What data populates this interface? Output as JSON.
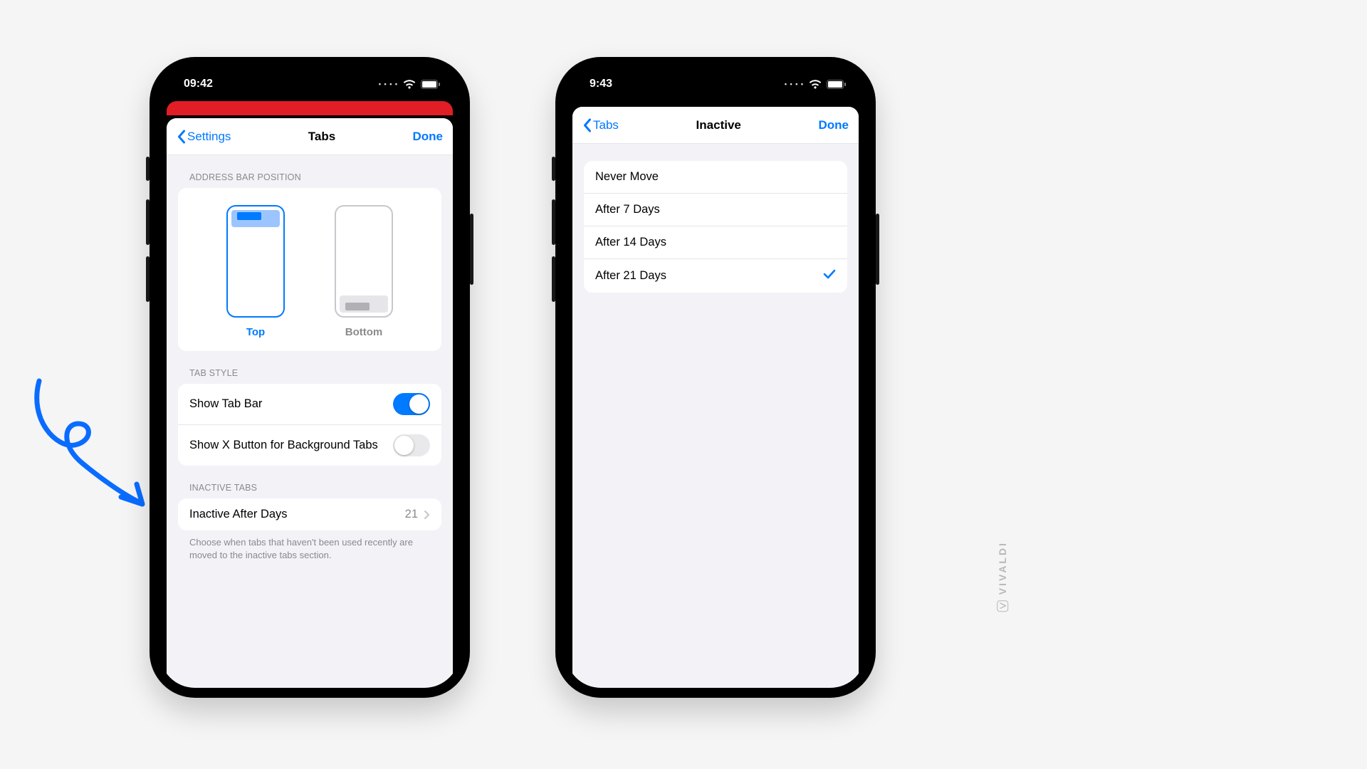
{
  "watermark": "VIVALDI",
  "left": {
    "status": {
      "time": "09:42"
    },
    "nav": {
      "back": "Settings",
      "title": "Tabs",
      "done": "Done"
    },
    "addressBarPosition": {
      "header": "ADDRESS BAR POSITION",
      "options": {
        "top": "Top",
        "bottom": "Bottom"
      },
      "selected": "top"
    },
    "tabStyle": {
      "header": "TAB STYLE",
      "showTabBar": {
        "label": "Show Tab Bar",
        "on": true
      },
      "showXButton": {
        "label": "Show X Button for Background Tabs",
        "on": false
      }
    },
    "inactiveTabs": {
      "header": "INACTIVE TABS",
      "row": {
        "label": "Inactive After Days",
        "value": "21"
      },
      "footer": "Choose when tabs that haven't been used recently are moved to the inactive tabs section."
    }
  },
  "right": {
    "status": {
      "time": "9:43"
    },
    "nav": {
      "back": "Tabs",
      "title": "Inactive",
      "done": "Done"
    },
    "options": [
      {
        "label": "Never Move",
        "selected": false
      },
      {
        "label": "After 7 Days",
        "selected": false
      },
      {
        "label": "After 14 Days",
        "selected": false
      },
      {
        "label": "After 21 Days",
        "selected": true
      }
    ]
  }
}
